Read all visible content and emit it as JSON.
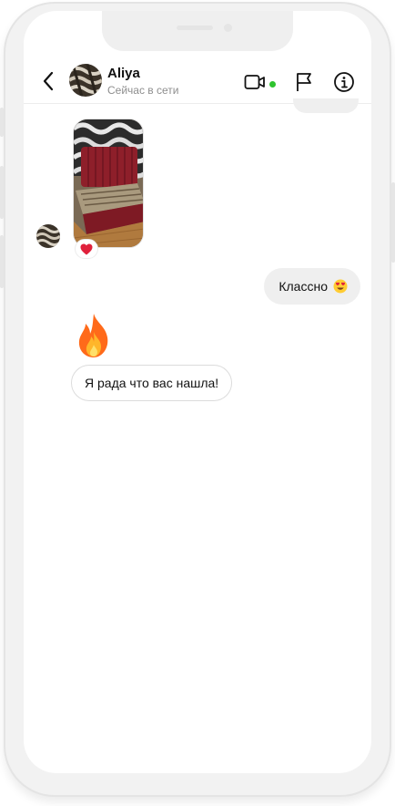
{
  "header": {
    "contact_name": "Aliya",
    "status": "Сейчас в сети",
    "icons": [
      "back-icon",
      "video-call-icon",
      "flag-icon",
      "info-icon"
    ],
    "online_color": "#2ec32e"
  },
  "messages": [
    {
      "direction": "incoming",
      "type": "photo",
      "reaction": "heart"
    },
    {
      "direction": "outgoing",
      "type": "text",
      "text": "Классно",
      "emoji": "heart-eyes"
    },
    {
      "direction": "incoming",
      "type": "emoji",
      "emoji": "fire"
    },
    {
      "direction": "incoming",
      "type": "text",
      "text": "Я рада что вас нашла!"
    }
  ]
}
